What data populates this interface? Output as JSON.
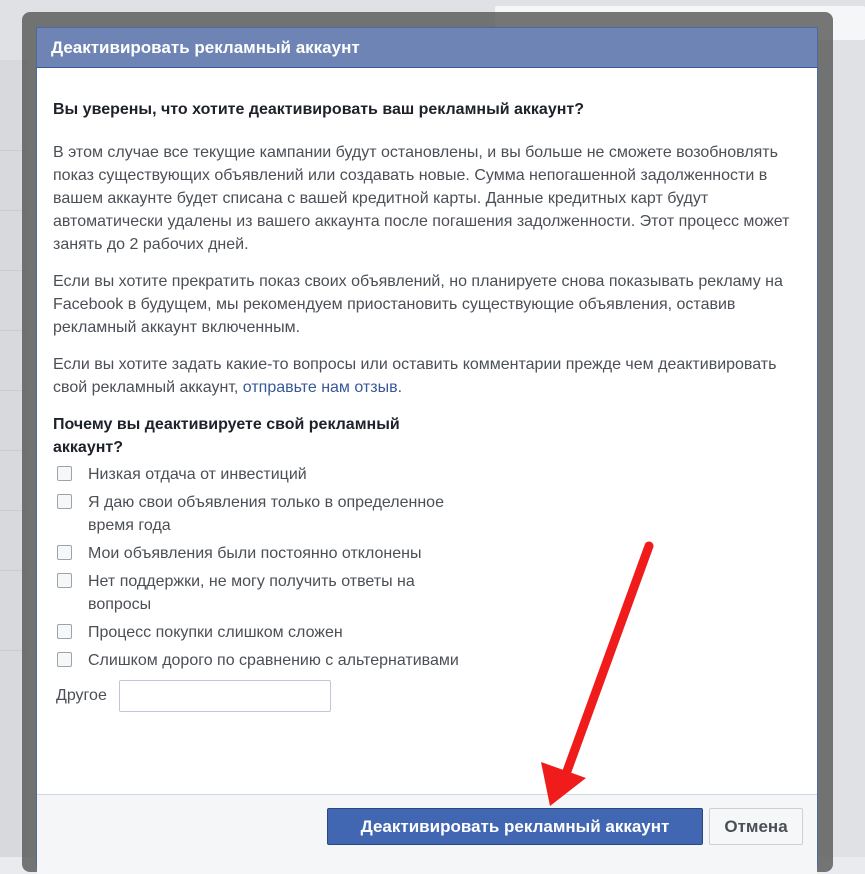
{
  "dialog": {
    "title": "Деактивировать рекламный аккаунт",
    "question": "Вы уверены, что хотите деактивировать ваш рекламный аккаунт?",
    "paragraph1": "В этом случае все текущие кампании будут остановлены, и вы больше не сможете возобновлять показ существующих объявлений или создавать новые. Сумма непогашенной задолженности в вашем аккаунте будет списана с вашей кредитной карты. Данные кредитных карт будут автоматически удалены из вашего аккаунта после погашения задолженности. Этот процесс может занять до 2 рабочих дней.",
    "paragraph2": "Если вы хотите прекратить показ своих объявлений, но планируете снова показывать рекламу на Facebook в будущем, мы рекомендуем приостановить существующие объявления, оставив рекламный аккаунт включенным.",
    "paragraph3_text": "Если вы хотите задать какие-то вопросы или оставить комментарии прежде чем деактивировать свой рекламный аккаунт, ",
    "paragraph3_link": "отправьте нам отзыв",
    "paragraph3_end": ".",
    "reasons_title": "Почему вы деактивируете свой рекламный аккаунт?",
    "reasons": [
      "Низкая отдача от инвестиций",
      "Я даю свои объявления только в определенное время года",
      "Мои объявления были постоянно отклонены",
      "Нет поддержки, не могу получить ответы на вопросы",
      "Процесс покупки слишком сложен",
      "Слишком дорого по сравнению с альтернативами"
    ],
    "other_label": "Другое",
    "other_value": "",
    "deactivate_button": "Деактивировать рекламный аккаунт",
    "cancel_button": "Отмена"
  },
  "colors": {
    "header": "#6d84b4",
    "primary_button": "#4267b2",
    "link": "#365899",
    "arrow": "#f01c1c"
  }
}
